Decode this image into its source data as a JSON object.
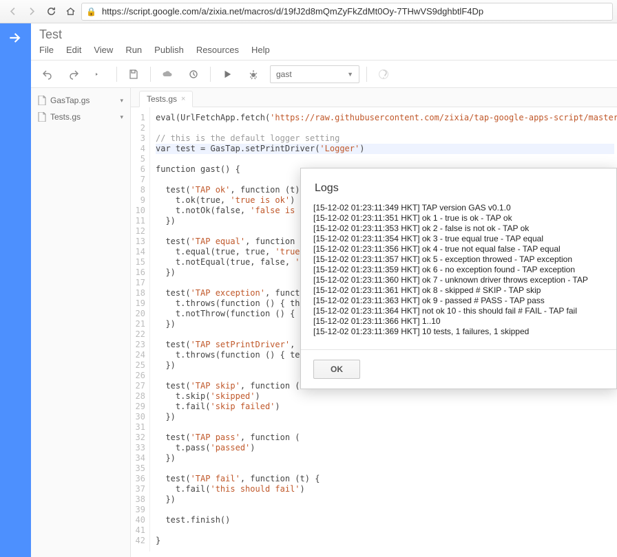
{
  "browser": {
    "url": "https://script.google.com/a/zixia.net/macros/d/19fJ2d8mQmZyFkZdMt0Oy-7THwVS9dghbtlF4Dp"
  },
  "app": {
    "title": "Test",
    "menus": [
      "File",
      "Edit",
      "View",
      "Run",
      "Publish",
      "Resources",
      "Help"
    ]
  },
  "toolbar": {
    "function_selector": "gast"
  },
  "sidebar": {
    "files": [
      {
        "name": "GasTap.gs"
      },
      {
        "name": "Tests.gs"
      }
    ]
  },
  "editor": {
    "tab": "Tests.gs",
    "lines": [
      {
        "type": "code",
        "text": "eval(UrlFetchApp.fetch('https://raw.githubusercontent.com/zixia/tap-google-apps-script/master/gas-"
      },
      {
        "type": "blank",
        "text": ""
      },
      {
        "type": "comment",
        "text": "// this is the default logger setting"
      },
      {
        "type": "code",
        "text": "var test = GasTap.setPrintDriver('Logger')"
      },
      {
        "type": "blank",
        "text": ""
      },
      {
        "type": "code",
        "text": "function gast() {"
      },
      {
        "type": "blank",
        "text": ""
      },
      {
        "type": "code",
        "text": "  test('TAP ok', function (t) {"
      },
      {
        "type": "code",
        "text": "    t.ok(true, 'true is ok')"
      },
      {
        "type": "code",
        "text": "    t.notOk(false, 'false is n"
      },
      {
        "type": "code",
        "text": "  })"
      },
      {
        "type": "blank",
        "text": ""
      },
      {
        "type": "code",
        "text": "  test('TAP equal', function ("
      },
      {
        "type": "code",
        "text": "    t.equal(true, true, 'true "
      },
      {
        "type": "code",
        "text": "    t.notEqual(true, false, '"
      },
      {
        "type": "code",
        "text": "  })"
      },
      {
        "type": "blank",
        "text": ""
      },
      {
        "type": "code",
        "text": "  test('TAP exception', funct"
      },
      {
        "type": "code",
        "text": "    t.throws(function () { th"
      },
      {
        "type": "code",
        "text": "    t.notThrow(function () {"
      },
      {
        "type": "code",
        "text": "  })"
      },
      {
        "type": "blank",
        "text": ""
      },
      {
        "type": "code",
        "text": "  test('TAP setPrintDriver',"
      },
      {
        "type": "code",
        "text": "    t.throws(function () { te"
      },
      {
        "type": "code",
        "text": "  })"
      },
      {
        "type": "blank",
        "text": ""
      },
      {
        "type": "code",
        "text": "  test('TAP skip', function ("
      },
      {
        "type": "code",
        "text": "    t.skip('skipped')"
      },
      {
        "type": "code",
        "text": "    t.fail('skip failed')"
      },
      {
        "type": "code",
        "text": "  })"
      },
      {
        "type": "blank",
        "text": ""
      },
      {
        "type": "code",
        "text": "  test('TAP pass', function ("
      },
      {
        "type": "code",
        "text": "    t.pass('passed')"
      },
      {
        "type": "code",
        "text": "  })"
      },
      {
        "type": "blank",
        "text": ""
      },
      {
        "type": "code",
        "text": "  test('TAP fail', function (t) {"
      },
      {
        "type": "code",
        "text": "    t.fail('this should fail')"
      },
      {
        "type": "code",
        "text": "  })"
      },
      {
        "type": "blank",
        "text": ""
      },
      {
        "type": "code",
        "text": "  test.finish()"
      },
      {
        "type": "blank",
        "text": ""
      },
      {
        "type": "code",
        "text": "}"
      }
    ]
  },
  "dialog": {
    "title": "Logs",
    "ok": "OK",
    "entries": [
      "[15-12-02 01:23:11:349 HKT] TAP version GAS v0.1.0",
      "[15-12-02 01:23:11:351 HKT] ok 1 - true is ok - TAP ok",
      "[15-12-02 01:23:11:353 HKT] ok 2 - false is not ok - TAP ok",
      "[15-12-02 01:23:11:354 HKT] ok 3 - true equal true - TAP equal",
      "[15-12-02 01:23:11:356 HKT] ok 4 - true not equal false - TAP equal",
      "[15-12-02 01:23:11:357 HKT] ok 5 - exception throwed - TAP exception",
      "[15-12-02 01:23:11:359 HKT] ok 6 - no exception found - TAP exception",
      "[15-12-02 01:23:11:360 HKT] ok 7 - unknown driver throws exception - TAP ",
      "[15-12-02 01:23:11:361 HKT] ok 8 - skipped # SKIP - TAP skip",
      "[15-12-02 01:23:11:363 HKT] ok 9 - passed # PASS - TAP pass",
      "[15-12-02 01:23:11:364 HKT] not ok 10 - this should fail # FAIL - TAP fail",
      "[15-12-02 01:23:11:366 HKT] 1..10",
      "[15-12-02 01:23:11:369 HKT] 10 tests, 1 failures, 1 skipped"
    ]
  }
}
